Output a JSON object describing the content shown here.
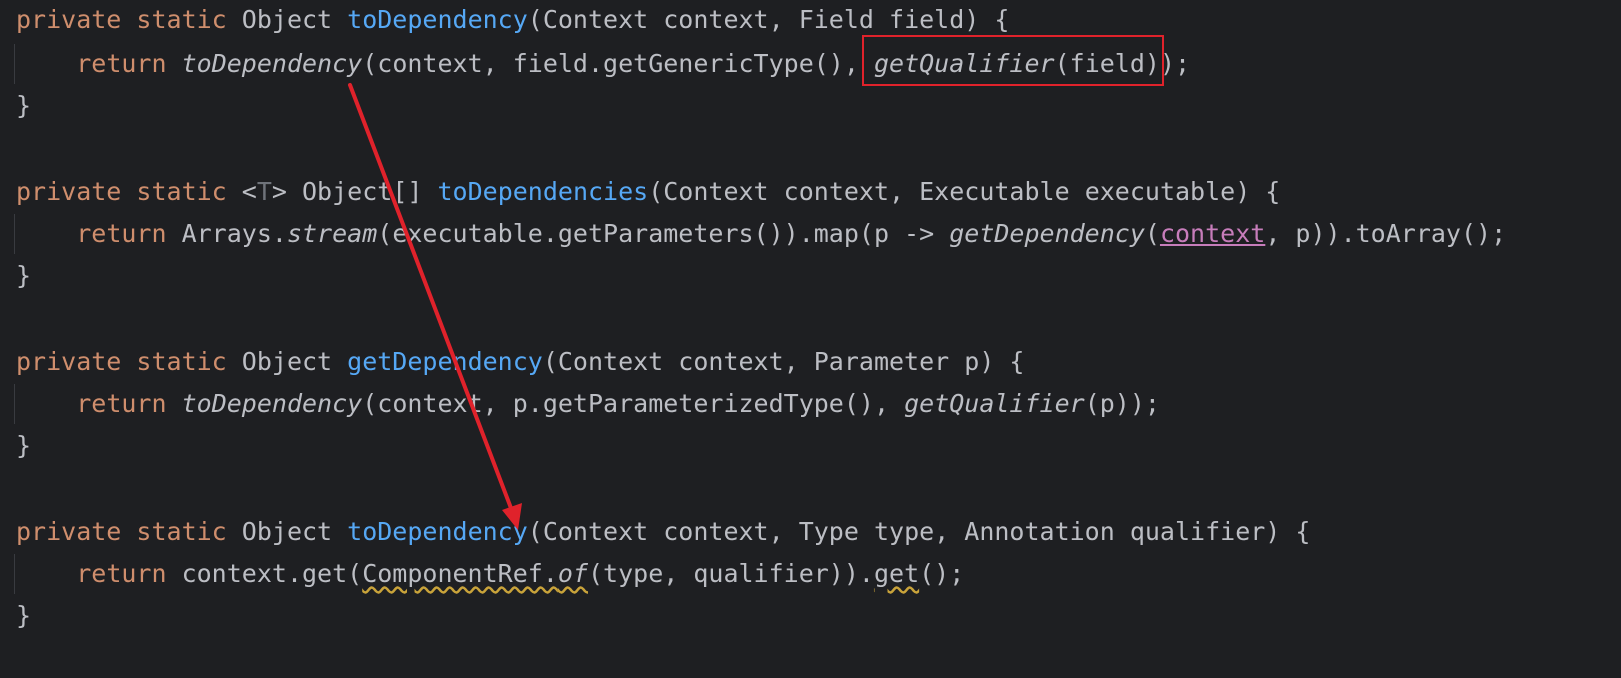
{
  "annotation_color": "#e0222b",
  "code": {
    "lines": [
      [
        {
          "t": "private",
          "c": "kw"
        },
        {
          "t": " "
        },
        {
          "t": "static",
          "c": "kw"
        },
        {
          "t": " Object "
        },
        {
          "t": "toDependency",
          "c": "fn-decl"
        },
        {
          "t": "(Context context, Field field) {"
        }
      ],
      [
        {
          "t": "    "
        },
        {
          "t": "return",
          "c": "kw"
        },
        {
          "t": " "
        },
        {
          "t": "toDependency",
          "c": "ital"
        },
        {
          "t": "(context, field.getGenericType(), "
        },
        {
          "t": "getQualifier",
          "c": "ital",
          "id": "qualifier-call"
        },
        {
          "t": "(field)",
          "id": "qualifier-args"
        },
        {
          "t": ");"
        }
      ],
      [
        {
          "t": "}"
        }
      ],
      [],
      [
        {
          "t": "private",
          "c": "kw"
        },
        {
          "t": " "
        },
        {
          "t": "static",
          "c": "kw"
        },
        {
          "t": " <"
        },
        {
          "t": "T",
          "c": "typeparam"
        },
        {
          "t": "> Object[] "
        },
        {
          "t": "toDependencies",
          "c": "fn-decl"
        },
        {
          "t": "(Context context, Executable executable) {"
        }
      ],
      [
        {
          "t": "    "
        },
        {
          "t": "return",
          "c": "kw"
        },
        {
          "t": " Arrays."
        },
        {
          "t": "stream",
          "c": "ital"
        },
        {
          "t": "(executable.getParameters()).map(p -> "
        },
        {
          "t": "getDependency",
          "c": "ital"
        },
        {
          "t": "("
        },
        {
          "t": "context",
          "c": "field-ref"
        },
        {
          "t": ", p)).toArray();"
        }
      ],
      [
        {
          "t": "}"
        }
      ],
      [],
      [
        {
          "t": "private",
          "c": "kw"
        },
        {
          "t": " "
        },
        {
          "t": "static",
          "c": "kw"
        },
        {
          "t": " Object "
        },
        {
          "t": "getDependency",
          "c": "fn-decl"
        },
        {
          "t": "(Context context, Parameter p) {"
        }
      ],
      [
        {
          "t": "    "
        },
        {
          "t": "return",
          "c": "kw"
        },
        {
          "t": " "
        },
        {
          "t": "toDependency",
          "c": "ital"
        },
        {
          "t": "(context, p.getParameterizedType(), "
        },
        {
          "t": "getQualifier",
          "c": "ital"
        },
        {
          "t": "(p));"
        }
      ],
      [
        {
          "t": "}"
        }
      ],
      [],
      [
        {
          "t": "private",
          "c": "kw"
        },
        {
          "t": " "
        },
        {
          "t": "static",
          "c": "kw"
        },
        {
          "t": " Object "
        },
        {
          "t": "toDependency",
          "c": "fn-decl"
        },
        {
          "t": "(Context context, Type type, Annotation qualifier) {"
        }
      ],
      [
        {
          "t": "    "
        },
        {
          "t": "return",
          "c": "kw"
        },
        {
          "t": " context.get("
        },
        {
          "t": "ComponentRef.",
          "c": "warn"
        },
        {
          "t": "of",
          "c": "ital warn"
        },
        {
          "t": "(type, qualifier))."
        },
        {
          "t": "get",
          "c": "warn"
        },
        {
          "t": "();"
        }
      ],
      [
        {
          "t": "}"
        }
      ]
    ]
  }
}
